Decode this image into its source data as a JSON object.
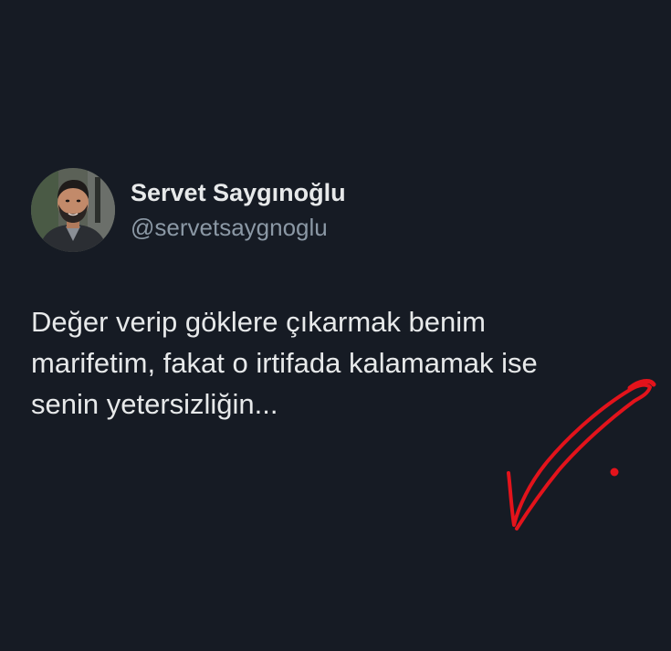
{
  "author": {
    "display_name": "Servet Saygınoğlu",
    "handle": "@servetsaygnoglu"
  },
  "tweet": {
    "lines": [
      "Değer verip göklere çıkarmak benim",
      "marifetim, fakat o irtifada kalamamak ise",
      "senin yetersizliğin..."
    ]
  },
  "colors": {
    "background": "#161b24",
    "text_primary": "#e7e9ea",
    "text_secondary": "#8b98a5",
    "annotation": "#e3131b"
  },
  "icons": {
    "annotation": "handwritten-check-mark"
  }
}
